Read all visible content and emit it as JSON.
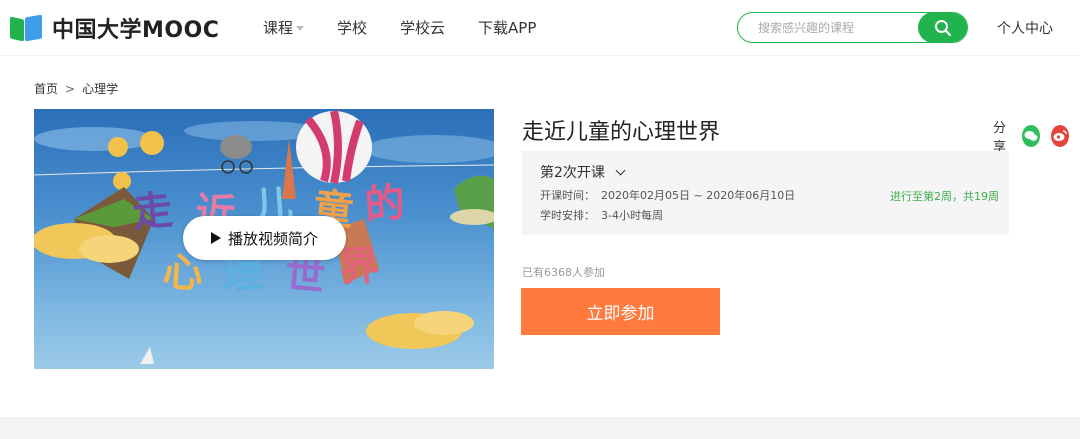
{
  "header": {
    "logo_text": "中国大学MOOC",
    "nav": [
      {
        "label": "课程",
        "has_dropdown": true
      },
      {
        "label": "学校",
        "has_dropdown": false
      },
      {
        "label": "学校云",
        "has_dropdown": false
      },
      {
        "label": "下载APP",
        "has_dropdown": false
      }
    ],
    "search": {
      "placeholder": "搜索感兴趣的课程",
      "value": ""
    },
    "user_center": "个人中心"
  },
  "breadcrumb": {
    "home": "首页",
    "separator": ">",
    "current": "心理学"
  },
  "cover": {
    "play_label": "播放视频简介",
    "title_art_text": "走近儿童的心理世界"
  },
  "course": {
    "title": "走近儿童的心理世界",
    "share_label": "分享",
    "share_icons": [
      "wechat-icon",
      "weibo-icon"
    ],
    "term": {
      "selected": "第2次开课",
      "time_label": "开课时间：",
      "time_value": "2020年02月05日 ~ 2020年06月10日",
      "schedule_label": "学时安排：",
      "schedule_value": "3-4小时每周",
      "progress": "进行至第2周，共19周"
    },
    "enroll_count": "已有6368人参加",
    "join_button": "立即参加"
  },
  "colors": {
    "brand_green": "#21b34d",
    "join_orange": "#ff7a3c",
    "progress_green": "#3cae4a",
    "wechat": "#2fbf5a",
    "weibo": "#e3453b"
  }
}
